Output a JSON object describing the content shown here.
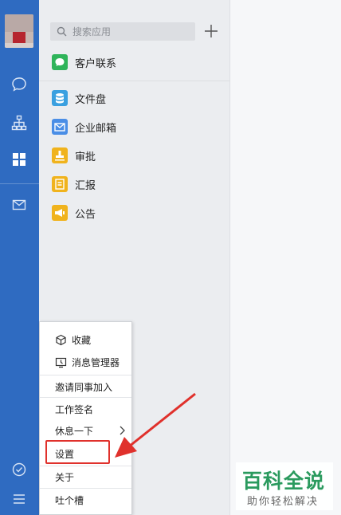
{
  "search": {
    "placeholder": "搜索应用"
  },
  "apps": [
    {
      "label": "客户联系",
      "icon": "chat-bubble-icon",
      "color": "#2fb45a"
    },
    {
      "label": "文件盘",
      "icon": "database-icon",
      "color": "#3aa0e0"
    },
    {
      "label": "企业邮箱",
      "icon": "envelope-icon",
      "color": "#4a8ee6"
    },
    {
      "label": "审批",
      "icon": "stamp-icon",
      "color": "#f0b31d"
    },
    {
      "label": "汇报",
      "icon": "document-icon",
      "color": "#f0b31d"
    },
    {
      "label": "公告",
      "icon": "megaphone-icon",
      "color": "#f0b31d"
    }
  ],
  "menu": {
    "favorites": "收藏",
    "message_manager": "消息管理器",
    "invite": "邀请同事加入",
    "work_signature": "工作签名",
    "take_break": "休息一下",
    "settings": "设置",
    "about": "关于",
    "feedback": "吐个槽"
  },
  "watermark": {
    "title": "百科全说",
    "subtitle": "助你轻松解决"
  },
  "colors": {
    "rail": "#2f6bc1",
    "highlight": "#e0312c",
    "watermark": "#2a9a5e"
  }
}
